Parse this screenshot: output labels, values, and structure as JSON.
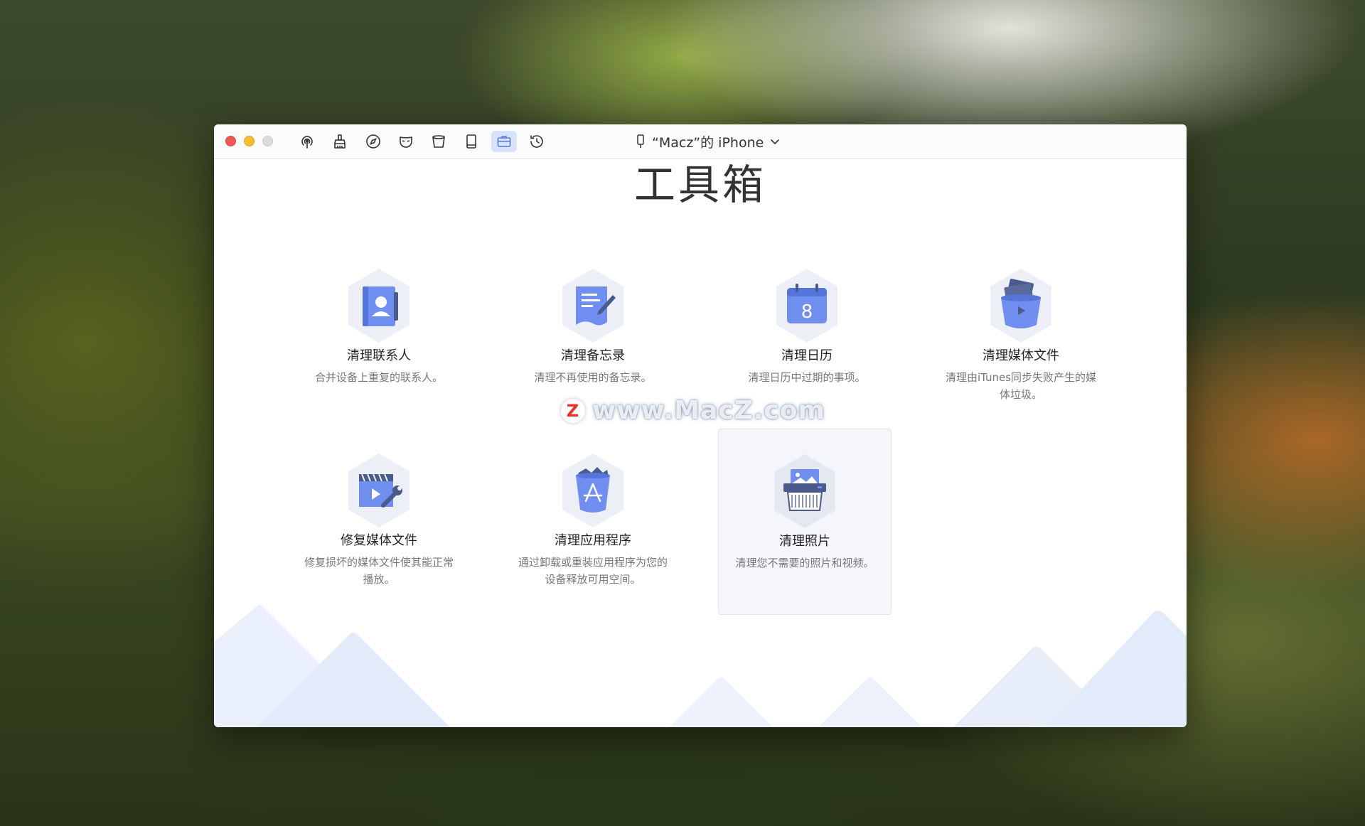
{
  "device": {
    "name": "“Macz”的 iPhone",
    "icon": "phone-icon",
    "chevron": "chevron-down-icon"
  },
  "toolbar": {
    "items": [
      {
        "icon": "airplay-icon"
      },
      {
        "icon": "broom-icon"
      },
      {
        "icon": "safari-icon"
      },
      {
        "icon": "mask-icon"
      },
      {
        "icon": "trash-bin-icon"
      },
      {
        "icon": "tablet-icon"
      },
      {
        "icon": "toolbox-icon",
        "active": true
      },
      {
        "icon": "history-clock-icon"
      }
    ]
  },
  "page": {
    "title": "工具箱"
  },
  "tools": [
    {
      "name": "清理联系人",
      "desc": "合并设备上重复的联系人。",
      "icon": "contacts-icon"
    },
    {
      "name": "清理备忘录",
      "desc": "清理不再使用的备忘录。",
      "icon": "notes-icon"
    },
    {
      "name": "清理日历",
      "desc": "清理日历中过期的事项。",
      "icon": "calendar-icon",
      "calendar_day": "8"
    },
    {
      "name": "清理媒体文件",
      "desc": "清理由iTunes同步失败产生的媒体垃圾。",
      "icon": "media-trash-icon"
    },
    {
      "name": "修复媒体文件",
      "desc": "修复损坏的媒体文件使其能正常播放。",
      "icon": "repair-media-icon"
    },
    {
      "name": "清理应用程序",
      "desc": "通过卸载或重装应用程序为您的设备释放可用空间。",
      "icon": "app-trash-icon"
    },
    {
      "name": "清理照片",
      "desc": "清理您不需要的照片和视频。",
      "icon": "photo-shredder-icon",
      "selected": true
    }
  ],
  "watermark": {
    "logo": "Z",
    "text": "www.MacZ.com"
  },
  "colors": {
    "accent": "#6f8ef0",
    "accent_dark": "#4a5a8c",
    "hex_bg": "#eceff5",
    "active_tab": "#d6e3fb"
  }
}
